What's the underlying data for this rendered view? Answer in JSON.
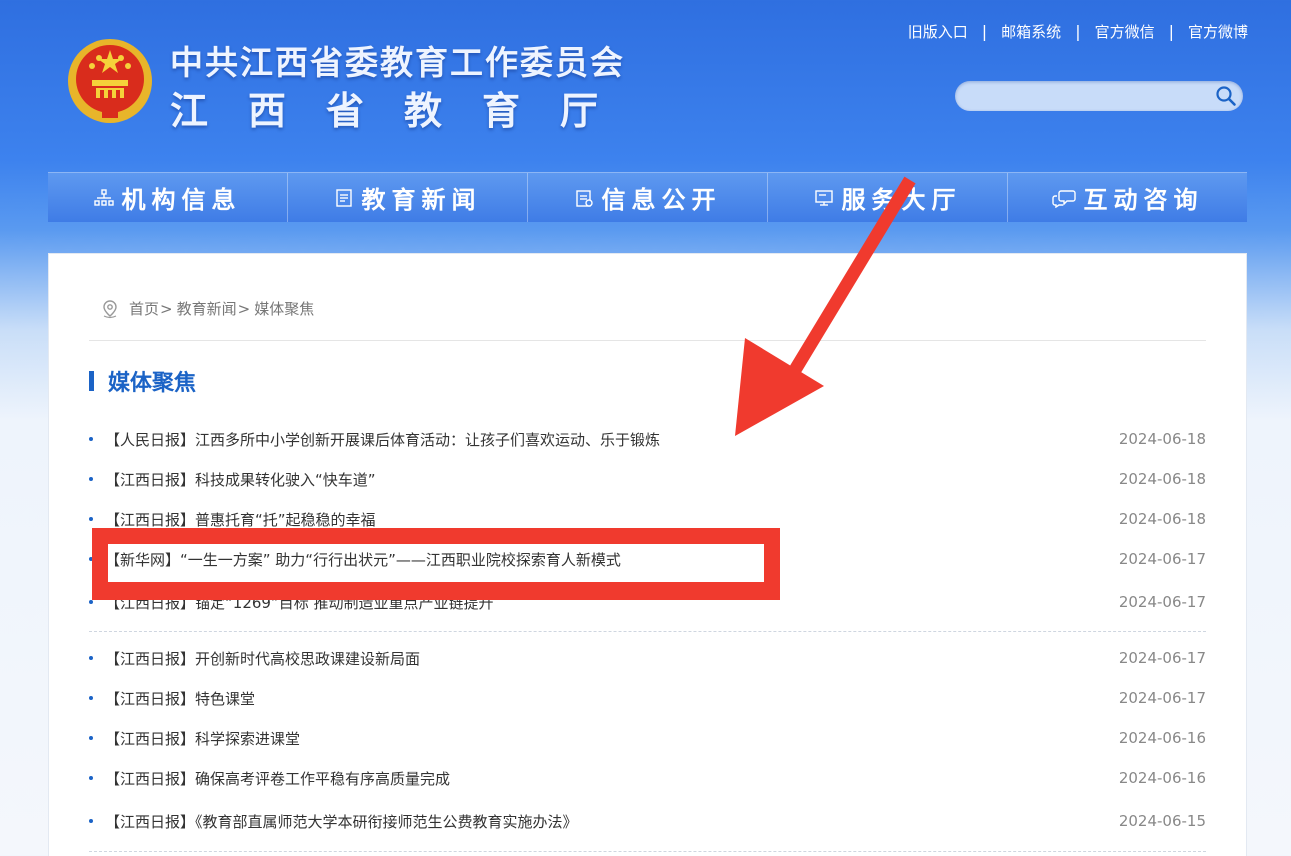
{
  "header": {
    "title_line1": "中共江西省委教育工作委员会",
    "title_line2": "江西省教育厅",
    "top_links": [
      "旧版入口",
      "邮箱系统",
      "官方微信",
      "官方微博"
    ],
    "search": {
      "placeholder": ""
    },
    "icons": [
      "national-emblem",
      "search-icon"
    ]
  },
  "nav": {
    "items": [
      {
        "label": "机构信息",
        "icon": "org-chart-icon"
      },
      {
        "label": "教育新闻",
        "icon": "document-icon"
      },
      {
        "label": "信息公开",
        "icon": "clipboard-icon"
      },
      {
        "label": "服务大厅",
        "icon": "monitor-icon"
      },
      {
        "label": "互动咨询",
        "icon": "chat-bubbles-icon"
      }
    ]
  },
  "breadcrumb": {
    "home": "首页",
    "level1": "教育新闻",
    "level2": "媒体聚焦",
    "separator": ">"
  },
  "section": {
    "title": "媒体聚焦"
  },
  "news": [
    {
      "title": "【人民日报】江西多所中小学创新开展课后体育活动：让孩子们喜欢运动、乐于锻炼",
      "date": "2024-06-18"
    },
    {
      "title": "【江西日报】科技成果转化驶入“快车道”",
      "date": "2024-06-18"
    },
    {
      "title": "【江西日报】普惠托育“托”起稳稳的幸福",
      "date": "2024-06-18"
    },
    {
      "title": "【新华网】“一生一方案” 助力“行行出状元”——江西职业院校探索育人新模式",
      "date": "2024-06-17"
    },
    {
      "title": "【江西日报】锚定“1269”目标 推动制造业重点产业链提升",
      "date": "2024-06-17"
    },
    {
      "title": "【江西日报】开创新时代高校思政课建设新局面",
      "date": "2024-06-17"
    },
    {
      "title": "【江西日报】特色课堂",
      "date": "2024-06-17"
    },
    {
      "title": "【江西日报】科学探索进课堂",
      "date": "2024-06-16"
    },
    {
      "title": "【江西日报】确保高考评卷工作平稳有序高质量完成",
      "date": "2024-06-16"
    },
    {
      "title": "【江西日报】《教育部直属师范大学本研衔接师范生公费教育实施办法》",
      "date": "2024-06-15"
    }
  ],
  "colors": {
    "accent": "#1b63c6",
    "annotation_red": "#f03a2e",
    "nav_blue": "#3f7ce6"
  }
}
